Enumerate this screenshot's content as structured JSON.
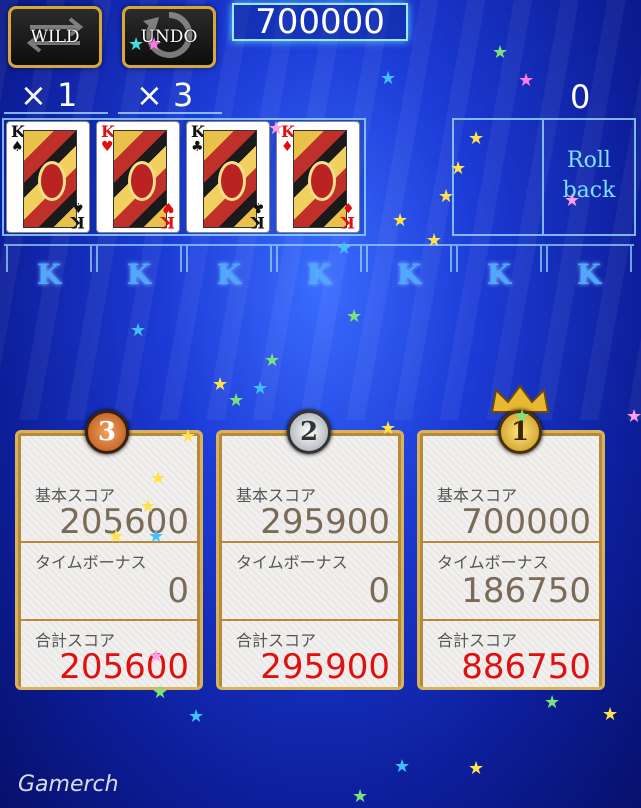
{
  "header": {
    "wild_label": "WILD",
    "undo_label": "UNDO",
    "wild_count": "× 1",
    "undo_count": "× 3",
    "top_score": "700000",
    "side_score": "0"
  },
  "cards": [
    {
      "rank": "K",
      "suit": "♠",
      "color": "blk"
    },
    {
      "rank": "K",
      "suit": "♥",
      "color": "red"
    },
    {
      "rank": "K",
      "suit": "♣",
      "color": "blk"
    },
    {
      "rank": "K",
      "suit": "♦",
      "color": "red"
    }
  ],
  "rollback": {
    "line1": "Roll",
    "line2": "back"
  },
  "columns": [
    "K",
    "K",
    "K",
    "K",
    "K",
    "K",
    "K"
  ],
  "results": [
    {
      "rank": "3",
      "base_label": "基本スコア",
      "base": "205600",
      "time_label": "タイムボーナス",
      "time": "0",
      "total_label": "合計スコア",
      "total": "205600"
    },
    {
      "rank": "2",
      "base_label": "基本スコア",
      "base": "295900",
      "time_label": "タイムボーナス",
      "time": "0",
      "total_label": "合計スコア",
      "total": "295900"
    },
    {
      "rank": "1",
      "base_label": "基本スコア",
      "base": "700000",
      "time_label": "タイムボーナス",
      "time": "186750",
      "total_label": "合計スコア",
      "total": "886750"
    }
  ],
  "watermark": "Gamerch",
  "colors": {
    "total_red": "#e01010",
    "gold_border": "#d9b35a",
    "k_blue": "#4fa7ff"
  }
}
